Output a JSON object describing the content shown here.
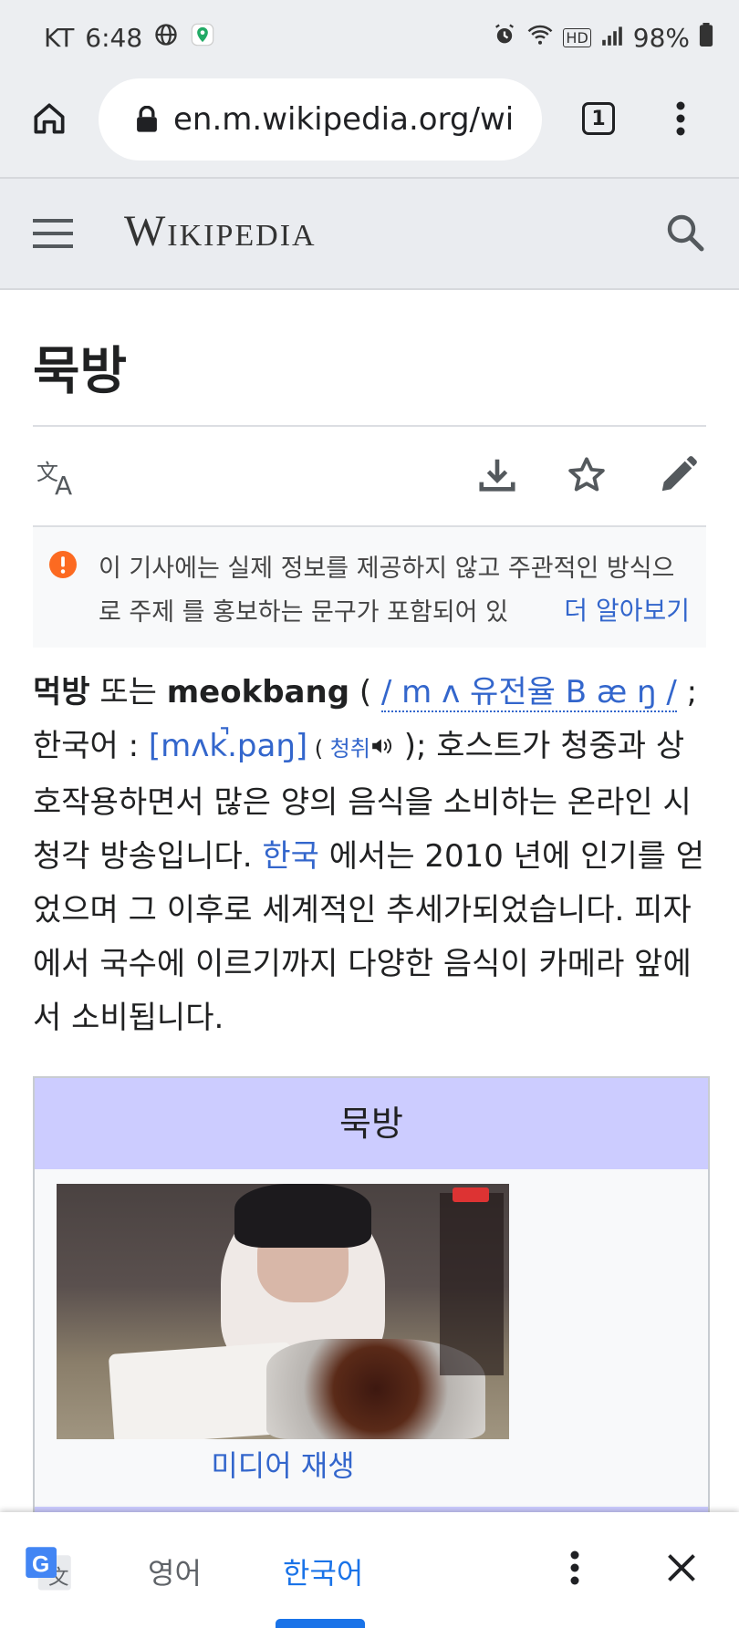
{
  "status_bar": {
    "carrier": "KT",
    "time": "6:48",
    "battery": "98%",
    "hd_label": "HD"
  },
  "browser": {
    "url": "en.m.wikipedia.org/wiki/Mukbang",
    "tab_count": "1"
  },
  "header": {
    "logo_text": "Wikipedia"
  },
  "article": {
    "title": "묵방",
    "notice_text": "이 기사에는 실제 정보를 제공하지 않고 주관적인 방식으로 주제 를 홍보하는 문구가 포함되어 있",
    "notice_more": "더 알아보기",
    "p_b1": "먹방",
    "p_t1": " 또는 ",
    "p_b2": "meokbang",
    "p_t2": " ( ",
    "p_ipa1": "/ m ʌ 유전율 B æ ŋ /",
    "p_t3": " ; 한국어 : ",
    "p_ipa2": "[mʌk̚.paŋ]",
    "p_t4": " ( ",
    "p_listen": "청취",
    "p_t5": " ); 호스트가 청중과 상호작용하면서 많은 양의 음식을 소비하는 온라인 시청각 방송입니다. ",
    "p_korea": "한국",
    "p_t6": " 에서는 2010 년에 인기를 얻었으며 그 이후로 세계적인 추세가되었습니다. 피자에서 국수에 이르기까지 다양한 음식이 카메라 앞에서 소비됩니다."
  },
  "infobox": {
    "title": "묵방",
    "media_link": "미디어 재생"
  },
  "translate_bar": {
    "lang_source": "영어",
    "lang_target": "한국어"
  },
  "colors": {
    "link": "#3366cc",
    "infobox_header": "#ccccff",
    "notice_icon": "#fc6a21",
    "translate_accent": "#1a73e8"
  }
}
